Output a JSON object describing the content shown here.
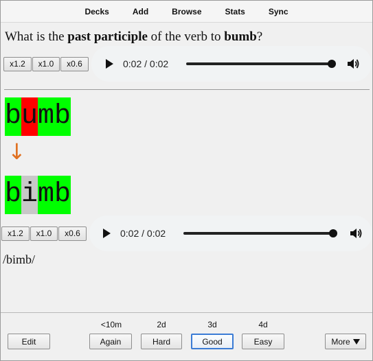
{
  "nav": {
    "items": [
      "Decks",
      "Add",
      "Browse",
      "Stats",
      "Sync"
    ]
  },
  "question": {
    "prefix": "What is the ",
    "term": "past participle",
    "middle": " of the verb to ",
    "verb": "bumb",
    "suffix": "?"
  },
  "audio1": {
    "speeds": [
      "x1.2",
      "x1.0",
      "x0.6"
    ],
    "time": "0:02 / 0:02",
    "progress": 1.0
  },
  "audio2": {
    "speeds": [
      "x1.2",
      "x1.0",
      "x0.6"
    ],
    "time": "0:02 / 0:02",
    "progress": 1.0
  },
  "word_before": {
    "segments": [
      {
        "text": "b",
        "color": "#00ff00"
      },
      {
        "text": "u",
        "color": "#ff0000"
      },
      {
        "text": "mb",
        "color": "#00ff00"
      }
    ]
  },
  "arrow": "↓",
  "arrow_color": "#e07020",
  "word_after": {
    "segments": [
      {
        "text": "b",
        "color": "#00ff00"
      },
      {
        "text": "i",
        "color": "#c8c8c8"
      },
      {
        "text": "mb",
        "color": "#00ff00"
      }
    ]
  },
  "ipa": "/bimb/",
  "bottom": {
    "edit_label": "Edit",
    "answers": [
      {
        "due": "<10m",
        "label": "Again"
      },
      {
        "due": "2d",
        "label": "Hard"
      },
      {
        "due": "3d",
        "label": "Good"
      },
      {
        "due": "4d",
        "label": "Easy"
      }
    ],
    "more_label": "More",
    "more_icon": "triangle-down-icon"
  }
}
